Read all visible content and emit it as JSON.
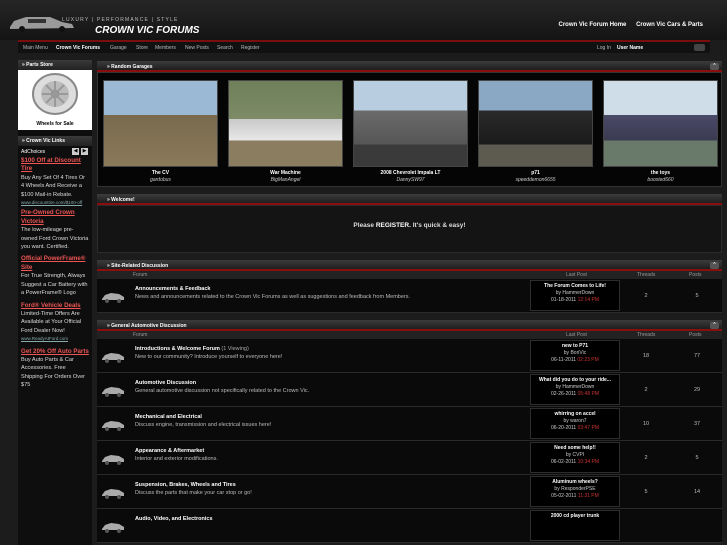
{
  "header": {
    "tagline": "LUXURY | PERFORMANCE | STYLE",
    "logo": "CROWN VIC FORUMS",
    "links": [
      "Crown Vic Forum Home",
      "Crown Vic Cars & Parts"
    ]
  },
  "nav": {
    "items": [
      "Main Menu",
      "Crown Vic Forums",
      "Garage",
      "Store",
      "Members",
      "New Posts",
      "Search",
      "Register"
    ],
    "login_label": "Log In",
    "user_name": "User Name"
  },
  "sidebar": {
    "parts_store": "Parts Store",
    "wheels_label": "Wheels for Sale",
    "links_title": "Crown Vic Links",
    "adchoices": "AdChoices",
    "ads": [
      {
        "title": "$100 Off at Discount Tire",
        "body": "Buy Any Set Of 4 Tires Or 4 Wheels And Receive a $100 Mail-in Rebate.",
        "url": "www.discounttire.com/$100-off"
      },
      {
        "title": "Pre-Owned Crown Victoria",
        "body": "The low-mileage pre-owned Ford Crown Victoria you want. Certified.",
        "url": ""
      },
      {
        "title": "Official PowerFrame® Site",
        "body": "For True Strength, Always Suggest a Car Battery with a PowerFrame® Logo",
        "url": ""
      },
      {
        "title": "Ford® Vehicle Deals",
        "body": "Limited-Time Offers Are Available at Your Official Ford Dealer Now!",
        "url": "www.ReadyAtFord.com"
      },
      {
        "title": "Get 20% Off Auto Parts",
        "body": "Buy Auto Parts & Car Accessories. Free Shipping For Orders Over $75",
        "url": ""
      }
    ]
  },
  "garages": {
    "title": "Random Garages",
    "items": [
      {
        "name": "The CV",
        "user": "gardobus"
      },
      {
        "name": "War Machine",
        "user": "BigManAngel"
      },
      {
        "name": "2008 Chevrolet Impala LT",
        "user": "DannySW97"
      },
      {
        "name": "p71",
        "user": "speeddemon6655"
      },
      {
        "name": "the toys",
        "user": "boosted660"
      }
    ]
  },
  "welcome": {
    "title": "Welcome!",
    "pre": "Please",
    "link": "REGISTER.",
    "post": "It's quick & easy!"
  },
  "cols": {
    "forum": "Forum",
    "last": "Last Post",
    "threads": "Threads",
    "posts": "Posts"
  },
  "site_section": {
    "title": "Site-Related Discussion",
    "rows": [
      {
        "title": "Announcements & Feedback",
        "viewing": "",
        "desc": "News and announcements related to the Crown Vic Forums as well as suggestions and feedback from Members.",
        "last_title": "The Forum Comes to Life!",
        "last_by": "by HammerDown",
        "last_date": "01-18-2011",
        "last_time": "12:14 PM",
        "threads": "2",
        "posts": "5"
      }
    ]
  },
  "general_section": {
    "title": "General Automotive Discussion",
    "rows": [
      {
        "title": "Introductions & Welcome Forum",
        "viewing": "(1 Viewing)",
        "desc": "New to our community? Introduce yourself to everyone here!",
        "last_title": "new to P71",
        "last_by": "by BoriVic",
        "last_date": "06-11-2011",
        "last_time": "02:23 PM",
        "threads": "18",
        "posts": "77"
      },
      {
        "title": "Automotive Discussion",
        "viewing": "",
        "desc": "General automotive discussion not specifically related to the Crown Vic.",
        "last_title": "What did you do to your ride...",
        "last_by": "by HammerDown",
        "last_date": "02-26-2011",
        "last_time": "05:48 PM",
        "threads": "2",
        "posts": "29"
      },
      {
        "title": "Mechanical and Electrical",
        "viewing": "",
        "desc": "Discuss engine, transmission and electrical issues here!",
        "last_title": "whirring on accel",
        "last_by": "by waron7",
        "last_date": "06-20-2011",
        "last_time": "03:47 PM",
        "threads": "10",
        "posts": "37"
      },
      {
        "title": "Appearance & Aftermarket",
        "viewing": "",
        "desc": "Interior and exterior modifications.",
        "last_title": "Need some help!!",
        "last_by": "by CVPI",
        "last_date": "06-02-2011",
        "last_time": "10:34 PM",
        "threads": "2",
        "posts": "5"
      },
      {
        "title": "Suspension, Brakes, Wheels and Tires",
        "viewing": "",
        "desc": "Discuss the parts that make your car stop or go!",
        "last_title": "Aluminum wheels?",
        "last_by": "by ResponderPSE",
        "last_date": "05-02-2011",
        "last_time": "11:31 PM",
        "threads": "5",
        "posts": "14"
      },
      {
        "title": "Audio, Video, and Electronics",
        "viewing": "",
        "desc": "",
        "last_title": "2000 cd player trunk",
        "last_by": "",
        "last_date": "",
        "last_time": "",
        "threads": "",
        "posts": ""
      }
    ]
  }
}
